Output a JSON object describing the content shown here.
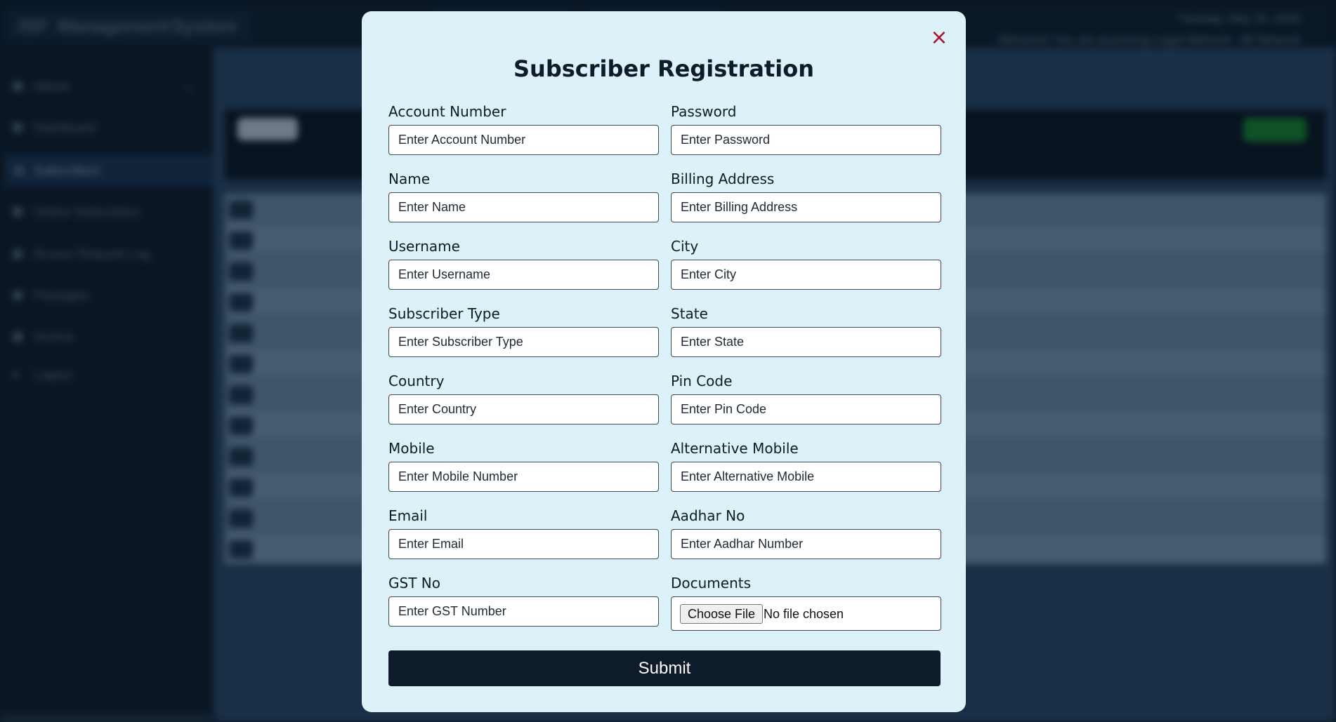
{
  "background": {
    "brand": [
      "ISP",
      "Management",
      "System"
    ],
    "date_text": "Tuesday, May 20, 2025",
    "access_text": "Welcome! You are accessing Legal Network - All Network",
    "sidebar_items": [
      "Admin",
      "Dashboard",
      "Subscribers",
      "Online Subscribers",
      "Access Request Log",
      "Packages",
      "Invoice",
      "Logout"
    ],
    "active_item": "Subscribers"
  },
  "modal": {
    "title": "Subscriber Registration",
    "close_symbol": "×",
    "fields": {
      "account_number": {
        "label": "Account Number",
        "placeholder": "Enter Account Number"
      },
      "password": {
        "label": "Password",
        "placeholder": "Enter Password"
      },
      "name": {
        "label": "Name",
        "placeholder": "Enter Name"
      },
      "billing_address": {
        "label": "Billing Address",
        "placeholder": "Enter Billing Address"
      },
      "username": {
        "label": "Username",
        "placeholder": "Enter Username"
      },
      "city": {
        "label": "City",
        "placeholder": "Enter City"
      },
      "subscriber_type": {
        "label": "Subscriber Type",
        "placeholder": "Enter Subscriber Type"
      },
      "state": {
        "label": "State",
        "placeholder": "Enter State"
      },
      "country": {
        "label": "Country",
        "placeholder": "Enter Country"
      },
      "pin_code": {
        "label": "Pin Code",
        "placeholder": "Enter Pin Code"
      },
      "mobile": {
        "label": "Mobile",
        "placeholder": "Enter Mobile Number"
      },
      "alternative_mobile": {
        "label": "Alternative Mobile",
        "placeholder": "Enter Alternative Mobile"
      },
      "email": {
        "label": "Email",
        "placeholder": "Enter Email"
      },
      "aadhar_no": {
        "label": "Aadhar No",
        "placeholder": "Enter Aadhar Number"
      },
      "gst_no": {
        "label": "GST No",
        "placeholder": "Enter GST Number"
      },
      "documents": {
        "label": "Documents",
        "button": "Choose File",
        "status": "No file chosen"
      }
    },
    "submit_label": "Submit"
  },
  "colors": {
    "modal_bg": "#dcf1f8",
    "primary": "#0d1b2a",
    "close": "#b0102b"
  }
}
